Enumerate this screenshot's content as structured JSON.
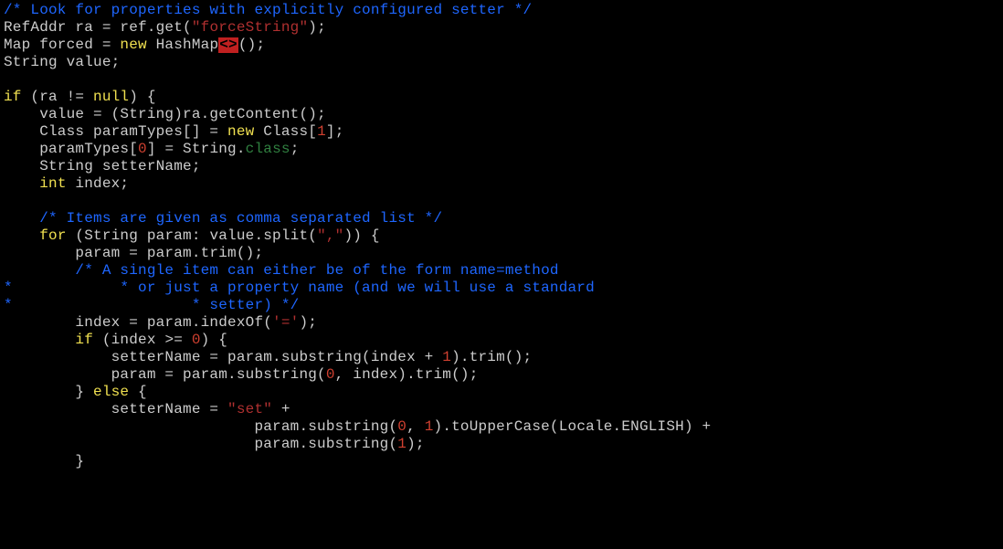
{
  "chart_data": null,
  "code": {
    "l1": "/* Look for properties with explicitly configured setter */",
    "l2a": "RefAddr ra = ref.get(",
    "l2s": "\"forceString\"",
    "l2b": ");",
    "l3a": "Map forced = ",
    "l3k": "new",
    "l3b": " HashMap",
    "l3d": "<>",
    "l3c": "();",
    "l4": "String value;",
    "l5": "",
    "l6a": "if",
    "l6b": " (ra != ",
    "l6n": "null",
    "l6c": ") {",
    "l7": "    value = (String)ra.getContent();",
    "l8a": "    Class paramTypes[] = ",
    "l8k": "new",
    "l8b": " Class[",
    "l8n": "1",
    "l8c": "];",
    "l9a": "    paramTypes[",
    "l9n": "0",
    "l9b": "] = String.",
    "l9c": "class",
    "l9d": ";",
    "l10": "    String setterName;",
    "l11a": "    ",
    "l11k": "int",
    "l11b": " index;",
    "l12": "",
    "l13": "    /* Items are given as comma separated list */",
    "l14a": "    ",
    "l14k": "for",
    "l14b": " (String param: value.split(",
    "l14s": "\",\"",
    "l14c": ")) {",
    "l15": "        param = param.trim();",
    "l16": "        /* A single item can either be of the form name=method",
    "l17": "*            * or just a property name (and we will use a standard",
    "l18": "*                    * setter) */",
    "l19a": "        index = param.indexOf(",
    "l19s": "'='",
    "l19b": ");",
    "l20a": "        ",
    "l20k": "if",
    "l20b": " (index >= ",
    "l20n": "0",
    "l20c": ") {",
    "l21a": "            setterName = param.substring(index + ",
    "l21n": "1",
    "l21b": ").trim();",
    "l22a": "            param = param.substring(",
    "l22n": "0",
    "l22b": ", index).trim();",
    "l23a": "        } ",
    "l23k": "else",
    "l23b": " {",
    "l24a": "            setterName = ",
    "l24s": "\"set\"",
    "l24b": " +",
    "l25a": "                            param.substring(",
    "l25n1": "0",
    "l25b": ", ",
    "l25n2": "1",
    "l25c": ").toUpperCase(Locale.ENGLISH) +",
    "l26a": "                            param.substring(",
    "l26n": "1",
    "l26b": ");",
    "l27": "        }"
  }
}
